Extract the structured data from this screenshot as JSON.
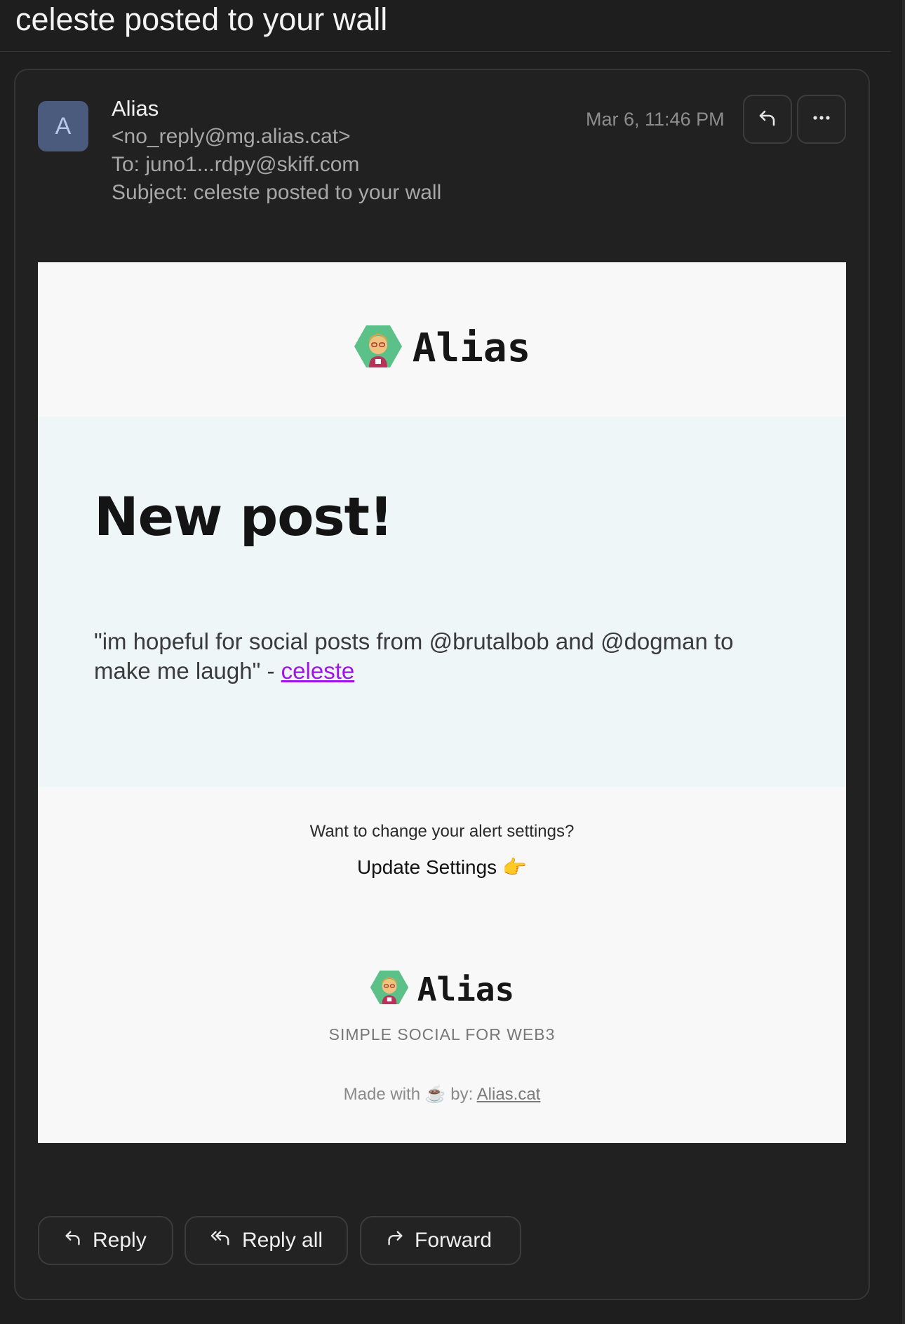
{
  "thread": {
    "title": "celeste posted to your wall"
  },
  "header": {
    "avatar_letter": "A",
    "sender_name": "Alias",
    "sender_email": "<no_reply@mg.alias.cat>",
    "to_line": "To: juno1...rdpy@skiff.com",
    "subject_line": "Subject: celeste posted to your wall",
    "timestamp": "Mar 6, 11:46 PM",
    "reply_icon": "reply-icon",
    "more_icon": "more-icon"
  },
  "email_body": {
    "brand_name": "Alias",
    "hero_title": "New post!",
    "post_text": "\"im hopeful for social posts from @brutalbob and @dogman to make me laugh\" - ",
    "post_author_link": "celeste",
    "alert_question": "Want to change your alert settings?",
    "update_settings_label": "Update Settings",
    "pointing_emoji": "👉",
    "footer_brand_name": "Alias",
    "tagline": "SIMPLE SOCIAL FOR WEB3",
    "made_with_prefix": "Made with",
    "coffee_emoji": "☕",
    "made_by_label": "by:",
    "made_by_link": "Alias.cat"
  },
  "actions": {
    "reply_label": "Reply",
    "reply_all_label": "Reply all",
    "forward_label": "Forward"
  },
  "colors": {
    "background": "#1e1e1e",
    "card": "#212121",
    "avatar": "#4a5b7e",
    "hero_bg": "#eef6f7",
    "link_purple": "#a213e6",
    "logo_green": "#5cc089"
  }
}
